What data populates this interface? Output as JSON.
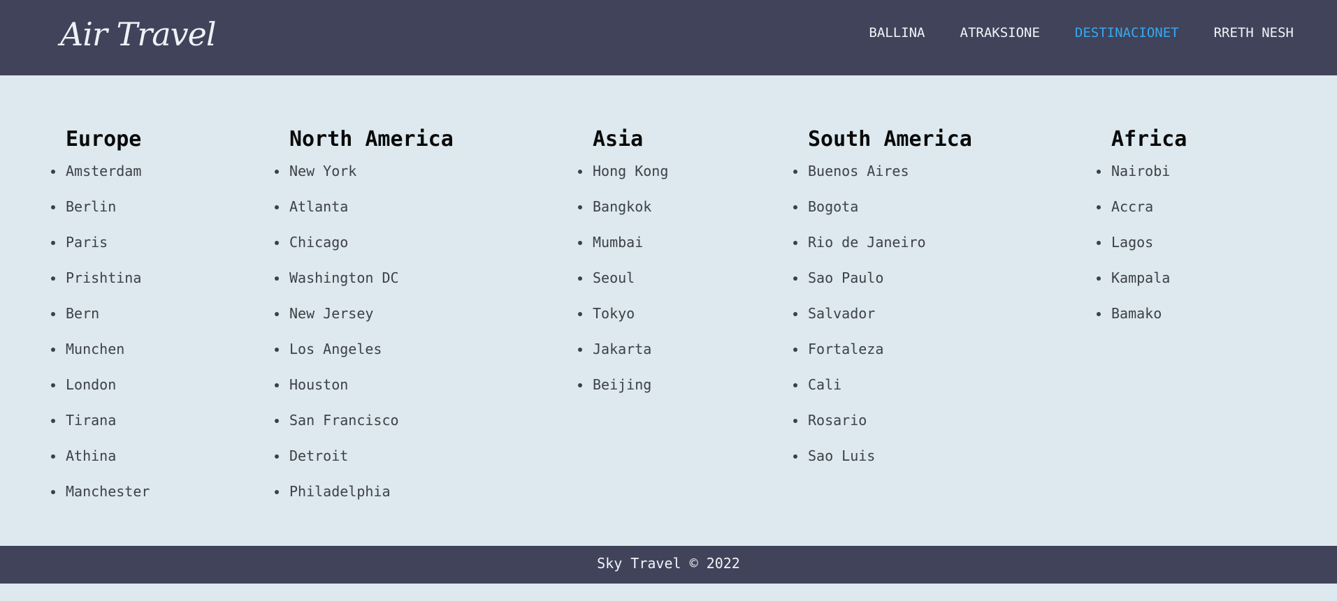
{
  "header": {
    "logo": "Air Travel",
    "nav": [
      {
        "label": "BALLINA"
      },
      {
        "label": "ATRAKSIONE"
      },
      {
        "label": "DESTINACIONET"
      },
      {
        "label": "RRETH NESH"
      }
    ],
    "active_color": "#35a9f0"
  },
  "regions": [
    {
      "title": "Europe",
      "cities": [
        "Amsterdam",
        "Berlin",
        "Paris",
        "Prishtina",
        "Bern",
        "Munchen",
        "London",
        "Tirana",
        "Athina",
        "Manchester"
      ]
    },
    {
      "title": "North America",
      "cities": [
        "New York",
        "Atlanta",
        "Chicago",
        "Washington DC",
        "New Jersey",
        "Los Angeles",
        "Houston",
        "San Francisco",
        "Detroit",
        "Philadelphia"
      ]
    },
    {
      "title": "Asia",
      "cities": [
        "Hong Kong",
        "Bangkok",
        "Mumbai",
        "Seoul",
        "Tokyo",
        "Jakarta",
        "Beijing"
      ]
    },
    {
      "title": "South America",
      "cities": [
        "Buenos Aires",
        "Bogota",
        "Rio de Janeiro",
        "Sao Paulo",
        "Salvador",
        "Fortaleza",
        "Cali",
        "Rosario",
        "Sao Luis"
      ]
    },
    {
      "title": "Africa",
      "cities": [
        "Nairobi",
        "Accra",
        "Lagos",
        "Kampala",
        "Bamako"
      ]
    }
  ],
  "footer": {
    "text": "Sky Travel © 2022"
  },
  "colors": {
    "header_bg": "#40435a",
    "page_bg": "#dde9ee"
  }
}
